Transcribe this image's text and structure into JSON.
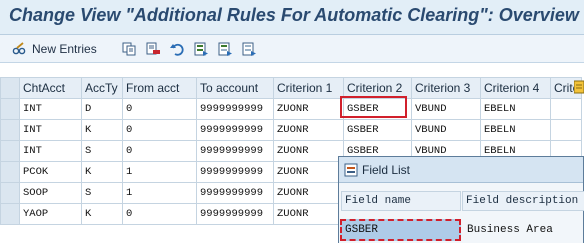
{
  "window": {
    "title": "Change View \"Additional Rules For Automatic Clearing\": Overview"
  },
  "toolbar": {
    "new_entries_label": "New Entries",
    "icons": [
      "glasses-pencil-icon",
      "copy-icon",
      "delete-icon",
      "undo-icon",
      "select-all-icon",
      "select-block-icon",
      "deselect-all-icon"
    ]
  },
  "table": {
    "columns": [
      "ChtAcct",
      "AccTy",
      "From acct",
      "To account",
      "Criterion 1",
      "Criterion 2",
      "Criterion 3",
      "Criterion 4",
      "Crite"
    ],
    "rows": [
      [
        "INT",
        "D",
        "0",
        "9999999999",
        "ZUONR",
        "GSBER",
        "VBUND",
        "EBELN",
        ""
      ],
      [
        "INT",
        "K",
        "0",
        "9999999999",
        "ZUONR",
        "GSBER",
        "VBUND",
        "EBELN",
        ""
      ],
      [
        "INT",
        "S",
        "0",
        "9999999999",
        "ZUONR",
        "GSBER",
        "VBUND",
        "EBELN",
        ""
      ],
      [
        "PCOK",
        "K",
        "1",
        "9999999999",
        "ZUONR",
        "",
        "",
        "",
        ""
      ],
      [
        "SOOP",
        "S",
        "1",
        "9999999999",
        "ZUONR",
        "",
        "",
        "",
        ""
      ],
      [
        "YAOP",
        "K",
        "0",
        "9999999999",
        "ZUONR",
        "",
        "",
        "",
        ""
      ]
    ]
  },
  "field_list": {
    "title": "Field List",
    "headers": [
      "Field name",
      "Field description"
    ],
    "row": {
      "name": "GSBER",
      "description": "Business Area"
    }
  },
  "colors": {
    "highlight": "#d1202c",
    "title_text": "#2a4a70"
  }
}
